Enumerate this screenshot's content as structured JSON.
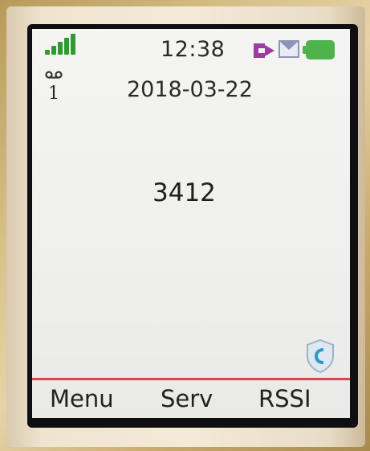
{
  "status_bar": {
    "time": "12:38",
    "signal_icon": "signal-bars-icon",
    "forward_icon": "call-forward-icon",
    "message_icon": "envelope-icon",
    "battery_icon": "battery-full-icon",
    "signal_color": "#2f9b2f",
    "battery_color": "#4db34a",
    "forward_color": "#9b3da0"
  },
  "voicemail": {
    "icon": "voicemail-icon",
    "count": "1"
  },
  "date": "2018-03-22",
  "extension_number": "3412",
  "security_icon": "shield-phone-icon",
  "divider_color": "#d8454b",
  "softkeys": {
    "left": "Menu",
    "middle": "Serv",
    "right": "RSSI"
  }
}
